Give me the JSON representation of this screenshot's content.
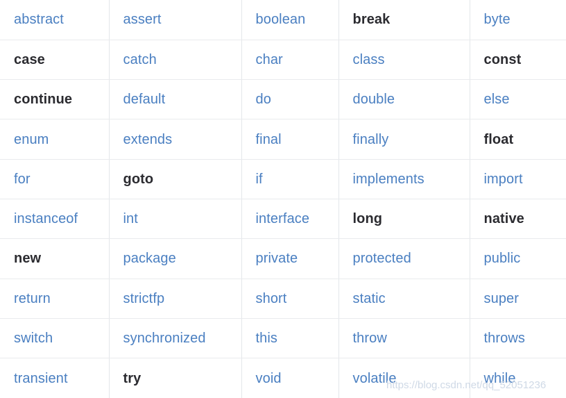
{
  "table": {
    "columns": 5,
    "rows": 10,
    "colors": {
      "link": "#4a7fc1",
      "plain": "#2b2b30",
      "border": "#e3e6ea",
      "background": "#ffffff",
      "watermark": "#cfd9e6"
    },
    "cells": [
      [
        {
          "text": "abstract",
          "style": "link"
        },
        {
          "text": "assert",
          "style": "link"
        },
        {
          "text": "boolean",
          "style": "link"
        },
        {
          "text": "break",
          "style": "plain"
        },
        {
          "text": "byte",
          "style": "link"
        }
      ],
      [
        {
          "text": "case",
          "style": "plain"
        },
        {
          "text": "catch",
          "style": "link"
        },
        {
          "text": "char",
          "style": "link"
        },
        {
          "text": "class",
          "style": "link"
        },
        {
          "text": "const",
          "style": "plain"
        }
      ],
      [
        {
          "text": "continue",
          "style": "plain"
        },
        {
          "text": "default",
          "style": "link"
        },
        {
          "text": "do",
          "style": "link"
        },
        {
          "text": "double",
          "style": "link"
        },
        {
          "text": "else",
          "style": "link"
        }
      ],
      [
        {
          "text": "enum",
          "style": "link"
        },
        {
          "text": "extends",
          "style": "link"
        },
        {
          "text": "final",
          "style": "link"
        },
        {
          "text": "finally",
          "style": "link"
        },
        {
          "text": "float",
          "style": "plain"
        }
      ],
      [
        {
          "text": "for",
          "style": "link"
        },
        {
          "text": "goto",
          "style": "plain"
        },
        {
          "text": "if",
          "style": "link"
        },
        {
          "text": "implements",
          "style": "link"
        },
        {
          "text": "import",
          "style": "link"
        }
      ],
      [
        {
          "text": "instanceof",
          "style": "link"
        },
        {
          "text": "int",
          "style": "link"
        },
        {
          "text": "interface",
          "style": "link"
        },
        {
          "text": "long",
          "style": "plain"
        },
        {
          "text": "native",
          "style": "plain"
        }
      ],
      [
        {
          "text": "new",
          "style": "plain"
        },
        {
          "text": "package",
          "style": "link"
        },
        {
          "text": "private",
          "style": "link"
        },
        {
          "text": "protected",
          "style": "link"
        },
        {
          "text": "public",
          "style": "link"
        }
      ],
      [
        {
          "text": "return",
          "style": "link"
        },
        {
          "text": "strictfp",
          "style": "link"
        },
        {
          "text": "short",
          "style": "link"
        },
        {
          "text": "static",
          "style": "link"
        },
        {
          "text": "super",
          "style": "link"
        }
      ],
      [
        {
          "text": "switch",
          "style": "link"
        },
        {
          "text": "synchronized",
          "style": "link"
        },
        {
          "text": "this",
          "style": "link"
        },
        {
          "text": "throw",
          "style": "link"
        },
        {
          "text": "throws",
          "style": "link"
        }
      ],
      [
        {
          "text": "transient",
          "style": "link"
        },
        {
          "text": "try",
          "style": "plain"
        },
        {
          "text": "void",
          "style": "link"
        },
        {
          "text": "volatile",
          "style": "link"
        },
        {
          "text": "while",
          "style": "link"
        }
      ]
    ]
  },
  "watermark": {
    "text": "https://blog.csdn.net/qq_52051236"
  }
}
